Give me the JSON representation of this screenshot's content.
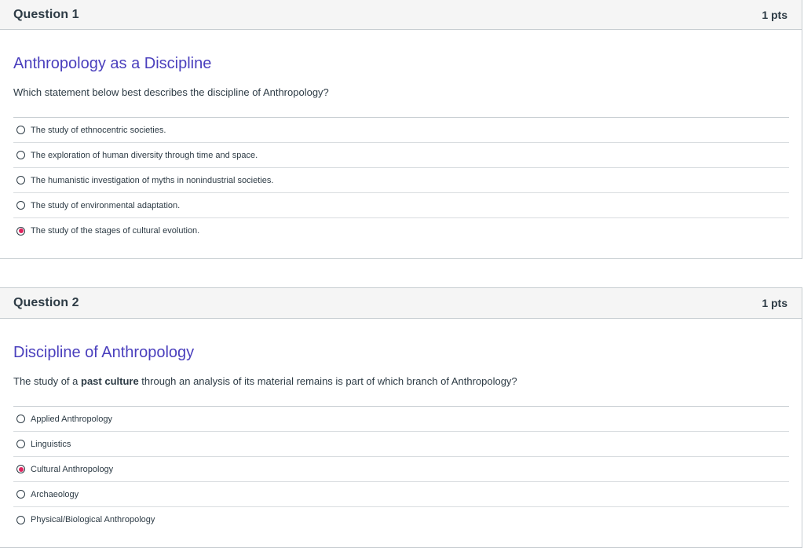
{
  "questions": [
    {
      "name": "Question 1",
      "points": "1 pts",
      "title": "Anthropology as a Discipline",
      "text": "Which statement below best describes the discipline of Anthropology?",
      "answers": [
        {
          "label": "The study of ethnocentric societies.",
          "selected": false
        },
        {
          "label": "The exploration of human diversity through time and space.",
          "selected": false
        },
        {
          "label": "The humanistic investigation of myths in nonindustrial societies.",
          "selected": false
        },
        {
          "label": "The study of environmental adaptation.",
          "selected": false
        },
        {
          "label": "The study of the stages of cultural evolution.",
          "selected": true
        }
      ]
    },
    {
      "name": "Question 2",
      "points": "1 pts",
      "title": "Discipline of Anthropology",
      "text_before": "The study of a ",
      "text_bold": "past culture",
      "text_after": " through an analysis of its material remains is part of which branch of Anthropology?",
      "answers": [
        {
          "label": "Applied Anthropology",
          "selected": false
        },
        {
          "label": "Linguistics",
          "selected": false
        },
        {
          "label": "Cultural Anthropology",
          "selected": true
        },
        {
          "label": "Archaeology",
          "selected": false
        },
        {
          "label": "Physical/Biological Anthropology",
          "selected": false
        }
      ]
    }
  ],
  "colors": {
    "title": "#4a3fbd",
    "selected_radio": "#e0245e",
    "header_bg": "#f5f5f5",
    "border": "#c7cdd1"
  }
}
